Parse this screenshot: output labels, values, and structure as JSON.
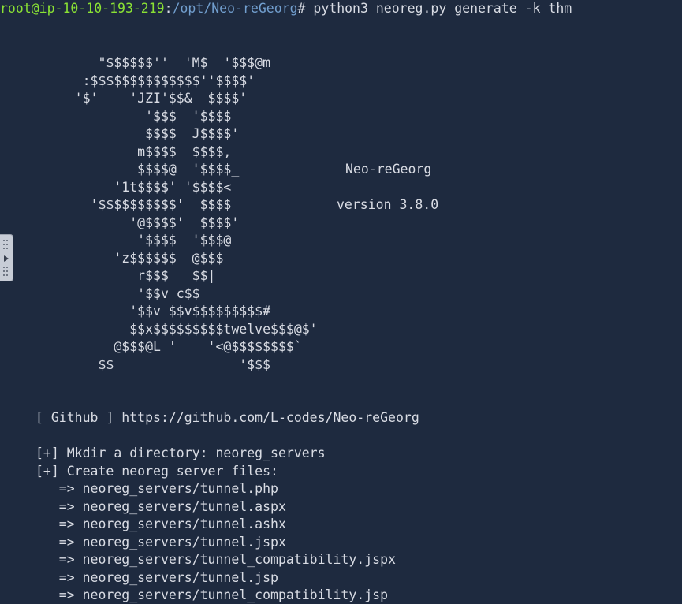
{
  "terminal": {
    "prompt": {
      "user_host": "root@ip-10-10-193-219",
      "sep": ":",
      "path": "/opt/Neo-reGeorg",
      "hash": "# ",
      "command": "python3 neoreg.py generate -k thm"
    },
    "ascii_art": [
      "        \"$$$$$$''  'M$  '$$$@m",
      "      :$$$$$$$$$$$$$$''$$$$'",
      "     '$'    'JZI'$$&  $$$$'",
      "              '$$$  '$$$$",
      "              $$$$  J$$$$'",
      "             m$$$$  $$$$,",
      "             $$$$@  '$$$$_",
      "          '1t$$$$' '$$$$<",
      "       '$$$$$$$$$$'  $$$$",
      "            '@$$$$'  $$$$'",
      "             '$$$$  '$$$@",
      "          'z$$$$$$  @$$$",
      "             r$$$   $$|",
      "             '$$v c$$",
      "            '$$v $$v$$$$$$$$$#",
      "            $$x$$$$$$$$$twelve$$$@$'",
      "          @$$$@L '    '<@$$$$$$$$`",
      "        $$                '$$$"
    ],
    "banner": {
      "name": "Neo-reGeorg",
      "version": "version 3.8.0"
    },
    "github_line": "[ Github ] https://github.com/L-codes/Neo-reGeorg",
    "output_lines": [
      "[+] Mkdir a directory: neoreg_servers",
      "[+] Create neoreg server files:",
      "   => neoreg_servers/tunnel.php",
      "   => neoreg_servers/tunnel.aspx",
      "   => neoreg_servers/tunnel.ashx",
      "   => neoreg_servers/tunnel.jspx",
      "   => neoreg_servers/tunnel_compatibility.jspx",
      "   => neoreg_servers/tunnel.jsp",
      "   => neoreg_servers/tunnel_compatibility.jsp"
    ]
  },
  "side_handle": {
    "icon": "chevron-right-icon"
  }
}
